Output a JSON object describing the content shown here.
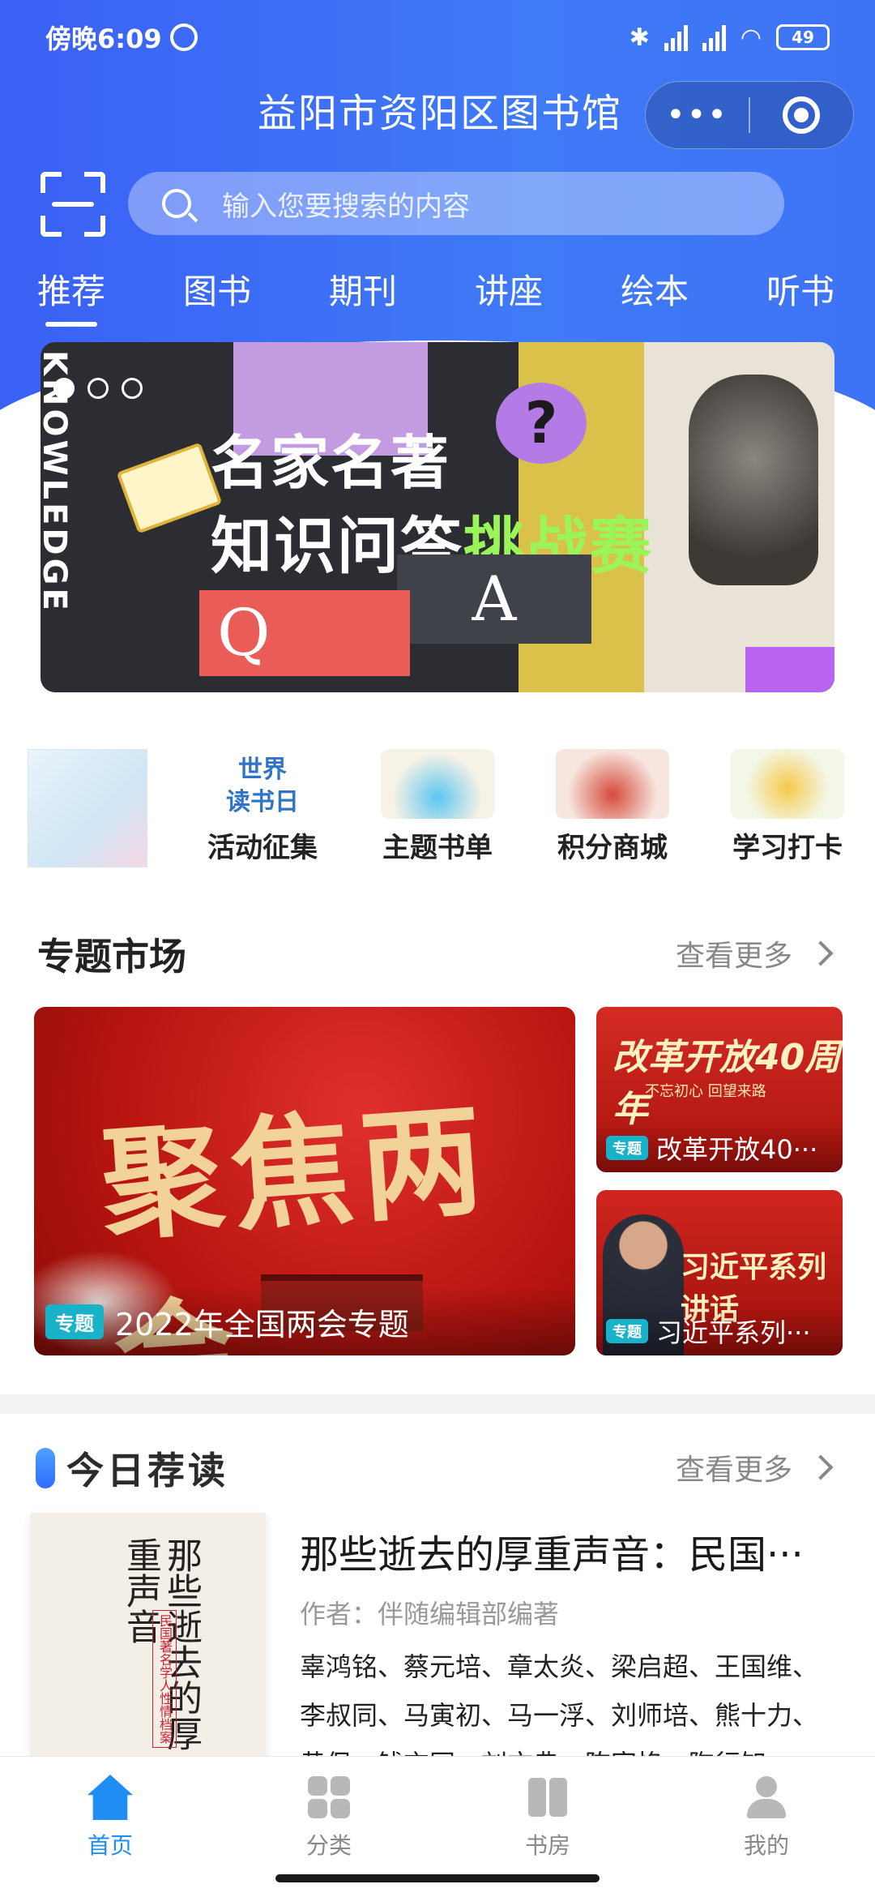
{
  "status_bar": {
    "time": "傍晚6:09",
    "battery": "49"
  },
  "header": {
    "title": "益阳市资阳区图书馆",
    "capsule_more": "•••",
    "search_placeholder": "输入您要搜索的内容"
  },
  "tabs": [
    "推荐",
    "图书",
    "期刊",
    "讲座",
    "绘本",
    "听书"
  ],
  "banner": {
    "side_text": "KNOWLEDGE",
    "line1": "名家名著",
    "line2_a": "知识问答",
    "line2_b": "挑战赛",
    "q": "Q",
    "a": "A",
    "qmark": "?"
  },
  "quick_entries": [
    {
      "label": "",
      "icon": "world-reading-day-poster"
    },
    {
      "label": "活动征集",
      "icon_text": "世界\n读书日",
      "icon": "world-book-day-icon"
    },
    {
      "label": "主题书单",
      "icon": "topic-booklist-icon"
    },
    {
      "label": "积分商城",
      "icon": "points-mall-icon"
    },
    {
      "label": "学习打卡",
      "icon": "study-checkin-icon"
    }
  ],
  "topic_market": {
    "title": "专题市场",
    "more": "查看更多",
    "big": {
      "badge": "专题",
      "title": "2022年全国两会专题",
      "art_text": "聚焦两会"
    },
    "small": [
      {
        "badge": "专题",
        "title": "改革开放40···",
        "art_text": "改革开放40周年",
        "art_sub": "不忘初心 回望来路"
      },
      {
        "badge": "专题",
        "title": "习近平系列···",
        "art_text": "习近平系列讲话"
      }
    ]
  },
  "today": {
    "title": "今日荐读",
    "more": "查看更多",
    "book": {
      "title": "那些逝去的厚重声音：民国···",
      "author": "作者：伴随编辑部编著",
      "desc": "辜鸿铭、蔡元培、章太炎、梁启超、王国维、李叔同、马寅初、马一浮、刘师培、熊十力、黄侃、钱玄同、刘文典、陈寅恪、陶行知",
      "cover_title": "那些逝去的厚重声音",
      "cover_sub": "民国著名学人性情档案"
    }
  },
  "bottom_nav": [
    {
      "label": "首页",
      "active": true
    },
    {
      "label": "分类",
      "active": false
    },
    {
      "label": "书房",
      "active": false
    },
    {
      "label": "我的",
      "active": false
    }
  ],
  "colors": {
    "accent": "#1e8ef5",
    "header": "#3f6ef6",
    "badge": "#19b3c9"
  }
}
